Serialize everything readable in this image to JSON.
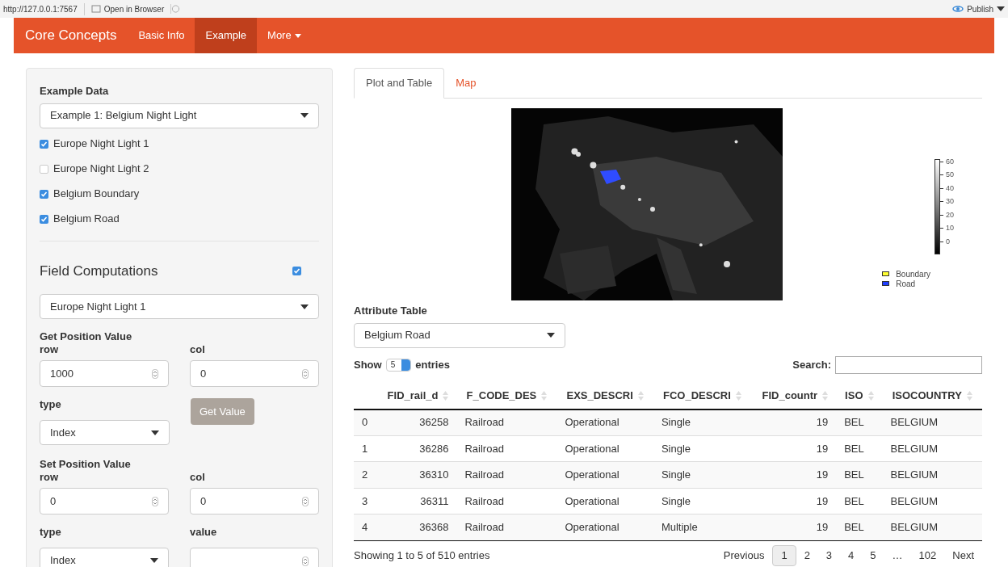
{
  "browser_bar": {
    "url": "http://127.0.0.1:7567",
    "open_button": "Open in Browser",
    "publish_button": "Publish"
  },
  "navbar": {
    "brand": "Core Concepts",
    "items": [
      {
        "label": "Basic Info",
        "selected": false,
        "dropdown": false
      },
      {
        "label": "Example",
        "selected": true,
        "dropdown": false
      },
      {
        "label": "More",
        "selected": false,
        "dropdown": true
      }
    ]
  },
  "sidebar": {
    "example_data": {
      "label": "Example Data",
      "value": "Example 1: Belgium Night Light"
    },
    "layers": [
      {
        "label": "Europe Night Light 1",
        "checked": true
      },
      {
        "label": "Europe Night Light 2",
        "checked": false
      },
      {
        "label": "Belgium Boundary",
        "checked": true
      },
      {
        "label": "Belgium Road",
        "checked": true
      }
    ],
    "field_computations": {
      "title": "Field Computations",
      "checked": true,
      "layer": "Europe Night Light 1"
    },
    "get_position": {
      "title": "Get Position Value",
      "row_label": "row",
      "row": "1000",
      "col_label": "col",
      "col": "0",
      "type_label": "type",
      "type": "Index",
      "button": "Get Value"
    },
    "set_position": {
      "title": "Set Position Value",
      "row_label": "row",
      "row": "0",
      "col_label": "col",
      "col": "0",
      "type_label": "type",
      "type": "Index",
      "value_label": "value"
    }
  },
  "tabs": [
    {
      "label": "Plot and Table",
      "selected": true
    },
    {
      "label": "Map",
      "selected": false
    }
  ],
  "plot": {
    "scale_ticks": [
      "60",
      "50",
      "40",
      "30",
      "20",
      "10",
      "0"
    ],
    "legend": [
      {
        "label": "Boundary",
        "color": "#ffff33"
      },
      {
        "label": "Road",
        "color": "#1f3fff"
      }
    ]
  },
  "attribute_table": {
    "label": "Attribute Table",
    "layer": "Belgium Road",
    "show_label": "Show",
    "page_size": "5",
    "entries_label": "entries",
    "search_label": "Search:",
    "columns": [
      "",
      "FID_rail_d",
      "F_CODE_DES",
      "EXS_DESCRI",
      "FCO_DESCRI",
      "FID_countr",
      "ISO",
      "ISOCOUNTRY"
    ],
    "rows": [
      [
        "0",
        "36258",
        "Railroad",
        "Operational",
        "Single",
        "19",
        "BEL",
        "BELGIUM"
      ],
      [
        "1",
        "36286",
        "Railroad",
        "Operational",
        "Single",
        "19",
        "BEL",
        "BELGIUM"
      ],
      [
        "2",
        "36310",
        "Railroad",
        "Operational",
        "Single",
        "19",
        "BEL",
        "BELGIUM"
      ],
      [
        "3",
        "36311",
        "Railroad",
        "Operational",
        "Single",
        "19",
        "BEL",
        "BELGIUM"
      ],
      [
        "4",
        "36368",
        "Railroad",
        "Operational",
        "Multiple",
        "19",
        "BEL",
        "BELGIUM"
      ]
    ],
    "info": "Showing 1 to 5 of 510 entries",
    "pagination": [
      {
        "label": "Previous",
        "selected": false
      },
      {
        "label": "1",
        "selected": true
      },
      {
        "label": "2",
        "selected": false
      },
      {
        "label": "3",
        "selected": false
      },
      {
        "label": "4",
        "selected": false
      },
      {
        "label": "5",
        "selected": false
      },
      {
        "label": "…",
        "selected": false
      },
      {
        "label": "102",
        "selected": false
      },
      {
        "label": "Next",
        "selected": false
      }
    ]
  }
}
